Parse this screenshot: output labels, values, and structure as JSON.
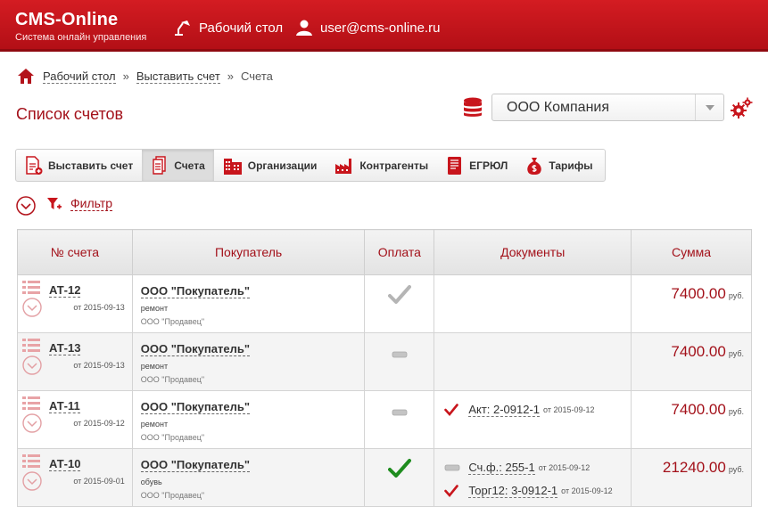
{
  "header": {
    "app_title": "CMS-Online",
    "app_subtitle": "Система онлайн управления",
    "dashboard_link": "Рабочий стол",
    "user_email": "user@cms-online.ru"
  },
  "breadcrumb": {
    "items": [
      "Рабочий стол",
      "Выставить счет"
    ],
    "current": "Счета",
    "separator": "»"
  },
  "page_title": "Список счетов",
  "company_select": {
    "value": "ООО Компания"
  },
  "tabs": [
    {
      "label": "Выставить счет",
      "icon": "new-document-icon"
    },
    {
      "label": "Счета",
      "icon": "documents-icon",
      "active": true
    },
    {
      "label": "Организации",
      "icon": "building-icon"
    },
    {
      "label": "Контрагенты",
      "icon": "factory-icon"
    },
    {
      "label": "ЕГРЮЛ",
      "icon": "registry-book-icon"
    },
    {
      "label": "Тарифы",
      "icon": "money-bag-icon"
    }
  ],
  "filter": {
    "label": "Фильтр"
  },
  "table": {
    "columns": [
      "№ счета",
      "Покупатель",
      "Оплата",
      "Документы",
      "Сумма"
    ],
    "rows": [
      {
        "number": "АТ-12",
        "date": "от 2015-09-13",
        "buyer": "ООО \"Покупатель\"",
        "note": "ремонт",
        "seller": "ООО \"Продавец\"",
        "payment": "paid-grey",
        "docs": [],
        "sum": "7400.00",
        "currency": "руб."
      },
      {
        "number": "АТ-13",
        "date": "от 2015-09-13",
        "buyer": "ООО \"Покупатель\"",
        "note": "ремонт",
        "seller": "ООО \"Продавец\"",
        "payment": "none",
        "docs": [],
        "sum": "7400.00",
        "currency": "руб."
      },
      {
        "number": "АТ-11",
        "date": "от 2015-09-12",
        "buyer": "ООО \"Покупатель\"",
        "note": "ремонт",
        "seller": "ООО \"Продавец\"",
        "payment": "none",
        "docs": [
          {
            "label": "Акт: 2-0912-1",
            "date": "от 2015-09-12",
            "status": "check"
          }
        ],
        "sum": "7400.00",
        "currency": "руб."
      },
      {
        "number": "АТ-10",
        "date": "от 2015-09-01",
        "buyer": "ООО \"Покупатель\"",
        "note": "обувь",
        "seller": "ООО \"Продавец\"",
        "payment": "paid-green",
        "docs": [
          {
            "label": "Сч.ф.: 255-1",
            "date": "от 2015-09-12",
            "status": "dash"
          },
          {
            "label": "Торг12: 3-0912-1",
            "date": "от 2015-09-12",
            "status": "check"
          }
        ],
        "sum": "21240.00",
        "currency": "руб."
      }
    ]
  },
  "colors": {
    "brand_red": "#c8151c",
    "accent_dark_red": "#a3111a",
    "paid_green": "#1e8c1e",
    "status_grey": "#b5b5b5"
  }
}
